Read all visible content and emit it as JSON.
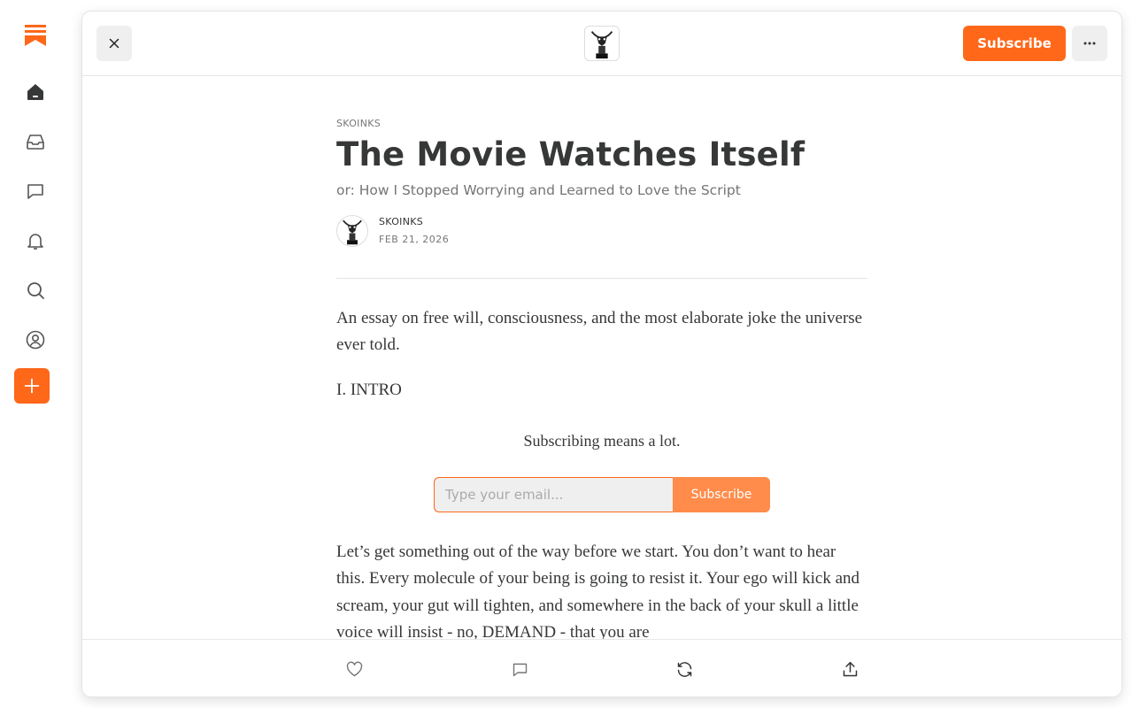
{
  "sidebar": {
    "items": [
      {
        "icon": "bookmark-logo-icon"
      },
      {
        "icon": "home-icon"
      },
      {
        "icon": "inbox-icon"
      },
      {
        "icon": "chat-icon"
      },
      {
        "icon": "bell-icon"
      },
      {
        "icon": "search-icon"
      },
      {
        "icon": "profile-icon"
      },
      {
        "icon": "plus-icon"
      }
    ]
  },
  "topbar": {
    "subscribe_label": "Subscribe"
  },
  "post": {
    "publication": "SKOINKS",
    "title": "The Movie Watches Itself",
    "subtitle": "or: How I Stopped Worrying and Learned to Love the Script",
    "author": "SKOINKS",
    "date": "FEB 21, 2026",
    "intro_paragraph": "An essay on free will, consciousness, and the most elaborate joke the universe ever told.",
    "section_heading": "I. INTRO",
    "body_paragraph": "Let’s get something out of the way before we start. You don’t want to hear this. Every molecule of your being is going to resist it. Your ego will kick and scream, your gut will tighten, and somewhere in the back of your skull a little voice will insist - no, DEMAND - that you are"
  },
  "subscribe_widget": {
    "prompt": "Subscribing means a lot.",
    "email_placeholder": "Type your email...",
    "button_label": "Subscribe"
  },
  "actions": [
    "heart-icon",
    "comment-icon",
    "restack-icon",
    "share-icon"
  ],
  "colors": {
    "accent": "#ff6719",
    "accent_light": "#ff8c4a",
    "text": "#363737",
    "muted": "#757575"
  }
}
